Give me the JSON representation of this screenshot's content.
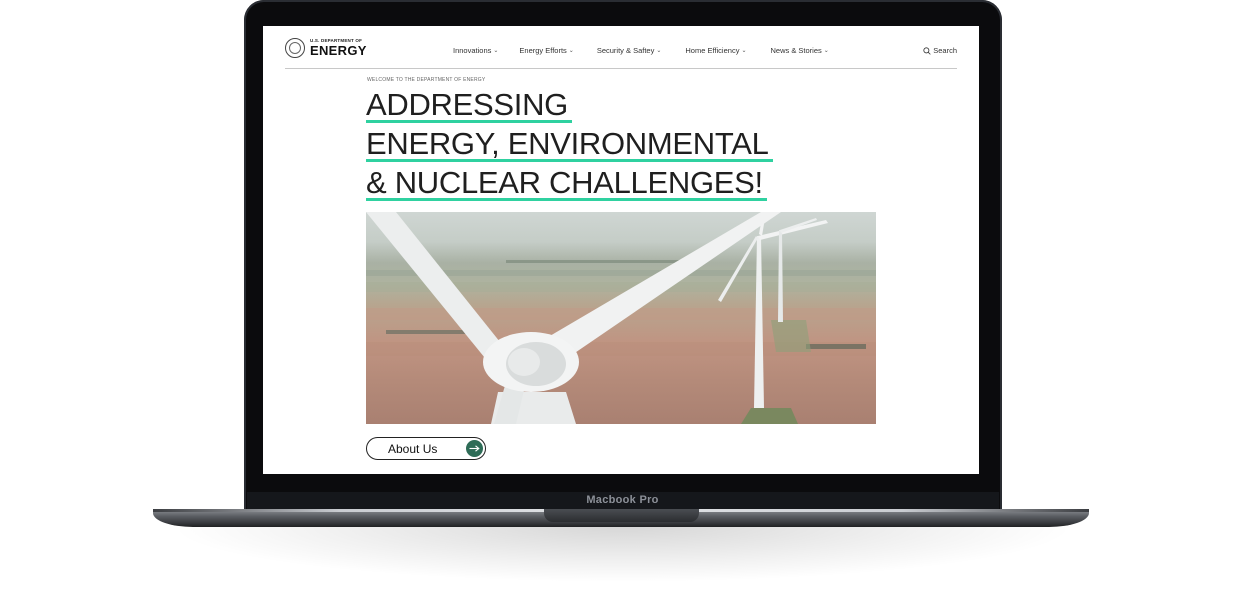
{
  "device": {
    "model_label": "Macbook Pro"
  },
  "site": {
    "logo": {
      "small_text": "U.S. DEPARTMENT OF",
      "big_text": "ENERGY"
    },
    "nav": [
      {
        "label": "Innovations"
      },
      {
        "label": "Energy Efforts"
      },
      {
        "label": "Security & Saftey"
      },
      {
        "label": "Home Efficiency"
      },
      {
        "label": "News & Stories"
      }
    ],
    "search_label": "Search"
  },
  "hero": {
    "welcome": "WELCOME TO THE DEPARTMENT OF ENERGY",
    "headline": [
      "ADDRESSING",
      "ENERGY, ENVIRONMENTAL",
      "& NUCLEAR CHALLENGES!"
    ],
    "cta_label": "About Us"
  },
  "colors": {
    "accent_underline": "#2fd1a0",
    "cta_arrow_bg": "#2e6c57",
    "laptop_bezel": "#0b0b0d"
  }
}
